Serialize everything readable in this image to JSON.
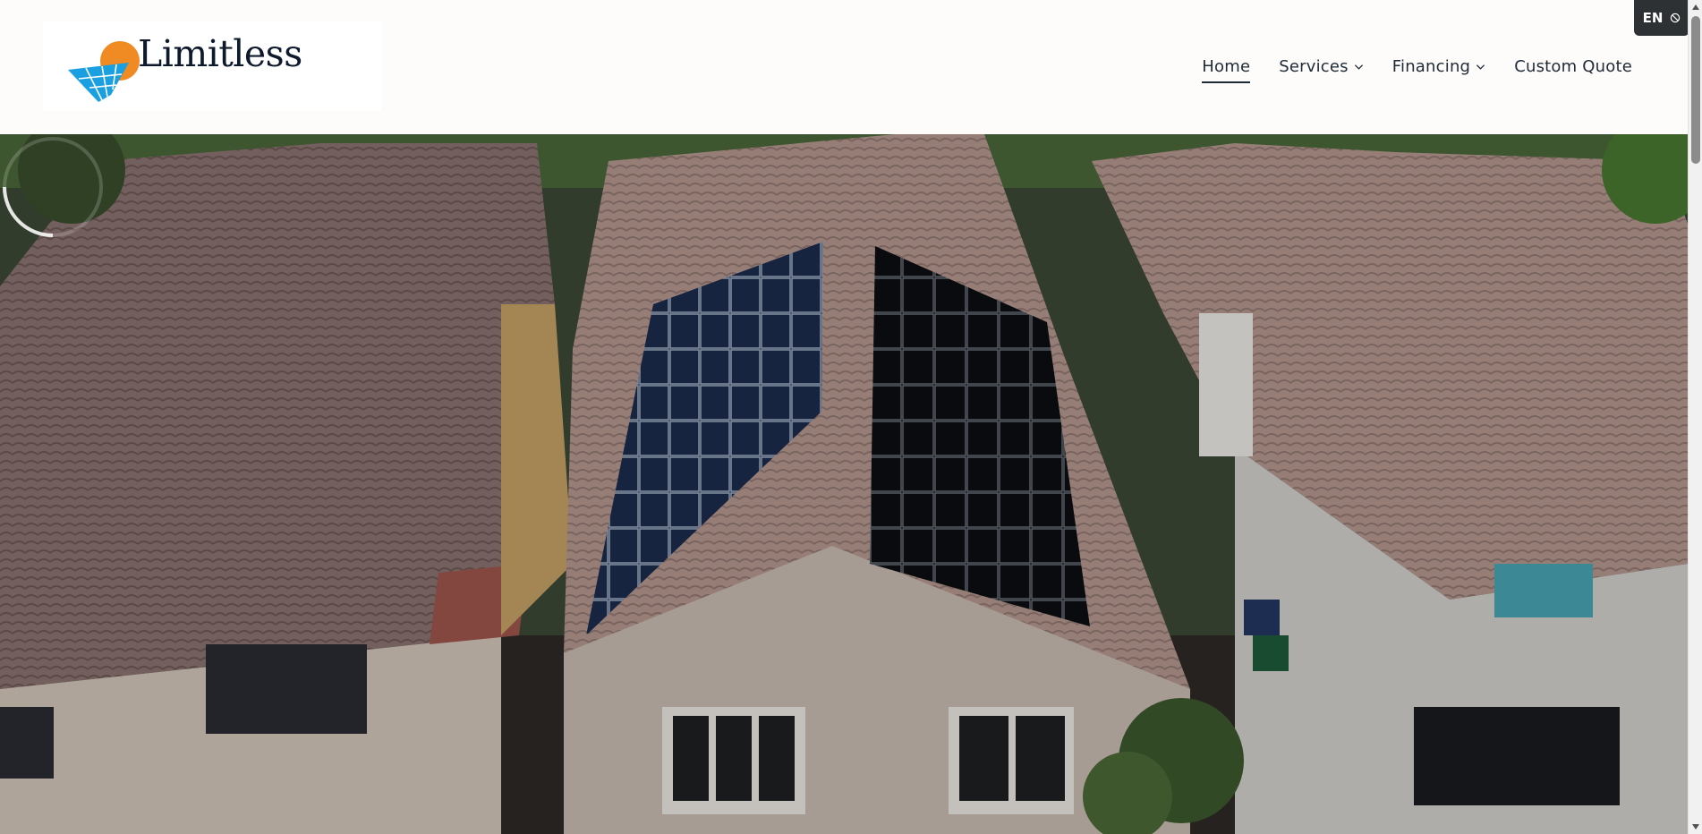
{
  "brand": {
    "name": "Limitless",
    "logo_icon": "solar-panel-sun-logo",
    "accent": "#f08a22",
    "panel_color": "#1aa0e0"
  },
  "nav": {
    "items": [
      {
        "label": "Home",
        "active": true,
        "dropdown": false
      },
      {
        "label": "Services",
        "active": false,
        "dropdown": true
      },
      {
        "label": "Financing",
        "active": false,
        "dropdown": true
      },
      {
        "label": "Custom Quote",
        "active": false,
        "dropdown": false
      }
    ]
  },
  "language": {
    "code": "EN",
    "icon": "globe-icon"
  },
  "hero": {
    "image": "aerial-houses-solar-panels",
    "loading_icon": "spinner-icon"
  },
  "colors": {
    "text": "#1f2a36",
    "header_bg": "#fdfcfb",
    "lang_bg": "#2e3134"
  }
}
